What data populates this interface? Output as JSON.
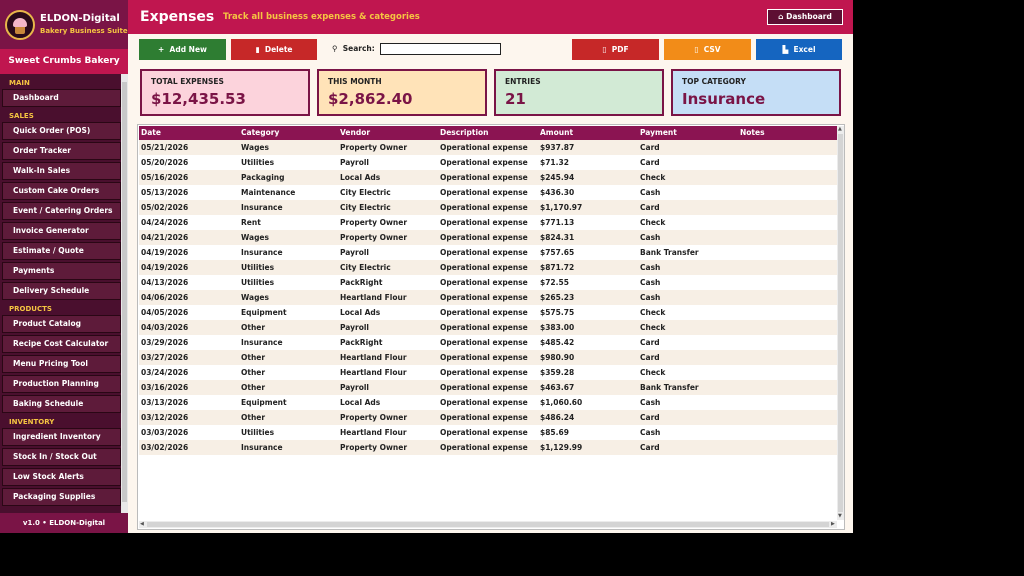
{
  "brand": {
    "title": "ELDON-Digital",
    "subtitle": "Bakery Business Suite",
    "logo_icon": "cupcake-icon"
  },
  "shop_name": "Sweet Crumbs Bakery",
  "nav": {
    "sections": [
      {
        "title": "MAIN",
        "items": [
          "Dashboard"
        ]
      },
      {
        "title": "SALES",
        "items": [
          "Quick Order (POS)",
          "Order Tracker",
          "Walk-In Sales",
          "Custom Cake Orders",
          "Event / Catering Orders",
          "Invoice Generator",
          "Estimate / Quote",
          "Payments",
          "Delivery Schedule"
        ]
      },
      {
        "title": "PRODUCTS",
        "items": [
          "Product Catalog",
          "Recipe Cost Calculator",
          "Menu Pricing Tool",
          "Production Planning",
          "Baking Schedule"
        ]
      },
      {
        "title": "INVENTORY",
        "items": [
          "Ingredient Inventory",
          "Stock In / Stock Out",
          "Low Stock Alerts",
          "Packaging Supplies"
        ]
      }
    ]
  },
  "version": "v1.0  •  ELDON-Digital",
  "header": {
    "title": "Expenses",
    "subtitle": "Track all business expenses & categories",
    "dashboard_button": "Dashboard"
  },
  "toolbar": {
    "add_label": "Add New",
    "delete_label": "Delete",
    "search_label": "Search:",
    "search_value": "",
    "pdf_label": "PDF",
    "csv_label": "CSV",
    "excel_label": "Excel"
  },
  "stats": {
    "total": {
      "label": "TOTAL EXPENSES",
      "value": "$12,435.53"
    },
    "month": {
      "label": "THIS MONTH",
      "value": "$2,862.40"
    },
    "entries": {
      "label": "ENTRIES",
      "value": "21"
    },
    "top": {
      "label": "TOP CATEGORY",
      "value": "Insurance"
    }
  },
  "table": {
    "columns": [
      "Date",
      "Category",
      "Vendor",
      "Description",
      "Amount",
      "Payment",
      "Notes"
    ],
    "rows": [
      [
        "05/21/2026",
        "Wages",
        "Property Owner",
        "Operational expense",
        "$937.87",
        "Card",
        ""
      ],
      [
        "05/20/2026",
        "Utilities",
        "Payroll",
        "Operational expense",
        "$71.32",
        "Card",
        ""
      ],
      [
        "05/16/2026",
        "Packaging",
        "Local Ads",
        "Operational expense",
        "$245.94",
        "Check",
        ""
      ],
      [
        "05/13/2026",
        "Maintenance",
        "City Electric",
        "Operational expense",
        "$436.30",
        "Cash",
        ""
      ],
      [
        "05/02/2026",
        "Insurance",
        "City Electric",
        "Operational expense",
        "$1,170.97",
        "Card",
        ""
      ],
      [
        "04/24/2026",
        "Rent",
        "Property Owner",
        "Operational expense",
        "$771.13",
        "Check",
        ""
      ],
      [
        "04/21/2026",
        "Wages",
        "Property Owner",
        "Operational expense",
        "$824.31",
        "Cash",
        ""
      ],
      [
        "04/19/2026",
        "Insurance",
        "Payroll",
        "Operational expense",
        "$757.65",
        "Bank Transfer",
        ""
      ],
      [
        "04/19/2026",
        "Utilities",
        "City Electric",
        "Operational expense",
        "$871.72",
        "Cash",
        ""
      ],
      [
        "04/13/2026",
        "Utilities",
        "PackRight",
        "Operational expense",
        "$72.55",
        "Cash",
        ""
      ],
      [
        "04/06/2026",
        "Wages",
        "Heartland Flour",
        "Operational expense",
        "$265.23",
        "Cash",
        ""
      ],
      [
        "04/05/2026",
        "Equipment",
        "Local Ads",
        "Operational expense",
        "$575.75",
        "Check",
        ""
      ],
      [
        "04/03/2026",
        "Other",
        "Payroll",
        "Operational expense",
        "$383.00",
        "Check",
        ""
      ],
      [
        "03/29/2026",
        "Insurance",
        "PackRight",
        "Operational expense",
        "$485.42",
        "Card",
        ""
      ],
      [
        "03/27/2026",
        "Other",
        "Heartland Flour",
        "Operational expense",
        "$980.90",
        "Card",
        ""
      ],
      [
        "03/24/2026",
        "Other",
        "Heartland Flour",
        "Operational expense",
        "$359.28",
        "Check",
        ""
      ],
      [
        "03/16/2026",
        "Other",
        "Payroll",
        "Operational expense",
        "$463.67",
        "Bank Transfer",
        ""
      ],
      [
        "03/13/2026",
        "Equipment",
        "Local Ads",
        "Operational expense",
        "$1,060.60",
        "Cash",
        ""
      ],
      [
        "03/12/2026",
        "Other",
        "Property Owner",
        "Operational expense",
        "$486.24",
        "Card",
        ""
      ],
      [
        "03/03/2026",
        "Utilities",
        "Heartland Flour",
        "Operational expense",
        "$85.69",
        "Cash",
        ""
      ],
      [
        "03/02/2026",
        "Insurance",
        "Property Owner",
        "Operational expense",
        "$1,129.99",
        "Card",
        ""
      ]
    ]
  },
  "colors": {
    "brand_dark": "#4a0f2e",
    "brand": "#c0164f",
    "accent": "#f5c542"
  },
  "icons": {
    "add": "plus-icon",
    "delete": "trash-icon",
    "search": "search-icon",
    "pdf": "pdf-file-icon",
    "csv": "csv-file-icon",
    "excel": "excel-icon",
    "dashboard": "home-icon"
  }
}
